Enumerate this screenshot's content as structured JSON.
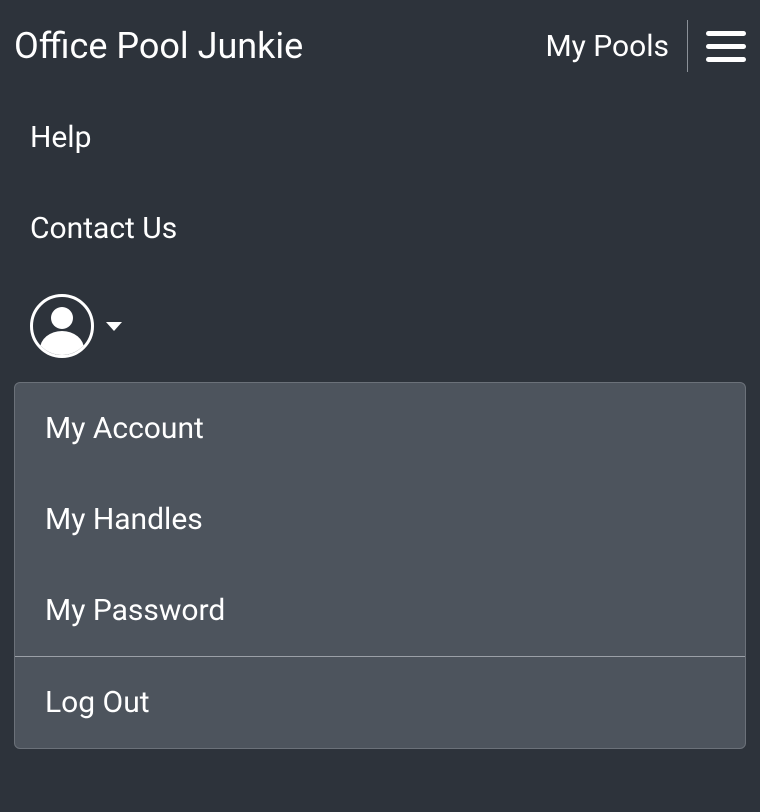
{
  "header": {
    "title": "Office Pool Junkie",
    "my_pools_label": "My Pools"
  },
  "menu": {
    "help_label": "Help",
    "contact_label": "Contact Us"
  },
  "dropdown": {
    "items": [
      {
        "label": "My Account"
      },
      {
        "label": "My Handles"
      },
      {
        "label": "My Password"
      }
    ],
    "logout_label": "Log Out"
  }
}
